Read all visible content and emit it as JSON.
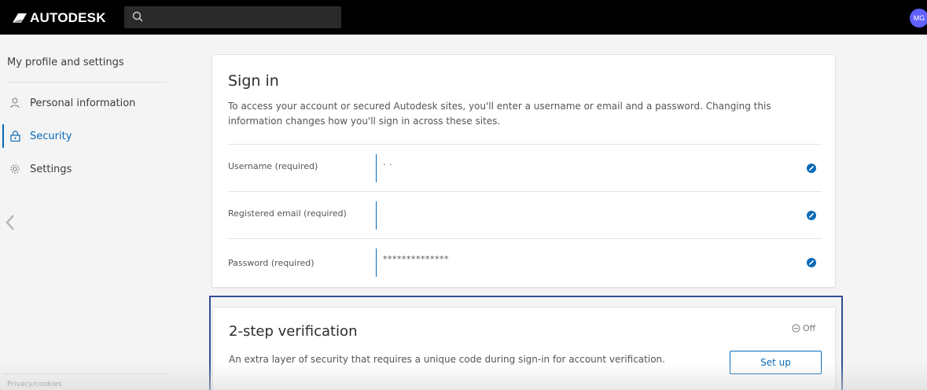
{
  "header": {
    "brand": "AUTODESK",
    "avatar_initials": "MG",
    "search_icon": "search-icon"
  },
  "sidebar": {
    "title": "My profile and settings",
    "items": [
      {
        "label": "Personal information",
        "icon": "person-icon",
        "active": false
      },
      {
        "label": "Security",
        "icon": "lock-icon",
        "active": true
      },
      {
        "label": "Settings",
        "icon": "gear-icon",
        "active": false
      }
    ],
    "footer_link": "Privacy/cookies"
  },
  "signin": {
    "title": "Sign in",
    "description": "To access your account or secured Autodesk sites, you'll enter a username or email and a password. Changing this information changes how you'll sign in across these sites.",
    "fields": [
      {
        "label": "Username (required)",
        "value": "· ·"
      },
      {
        "label": "Registered email (required)",
        "value": ""
      },
      {
        "label": "Password (required)",
        "value": "**************"
      }
    ]
  },
  "two_step": {
    "title": "2-step verification",
    "description": "An extra layer of security that requires a unique code during sign-in for account verification.",
    "status": "Off",
    "button_label": "Set up"
  },
  "colors": {
    "accent": "#0a6ab6",
    "topbar": "#000000",
    "avatar": "#5f60ff",
    "focus_border": "#2f4f8f"
  }
}
